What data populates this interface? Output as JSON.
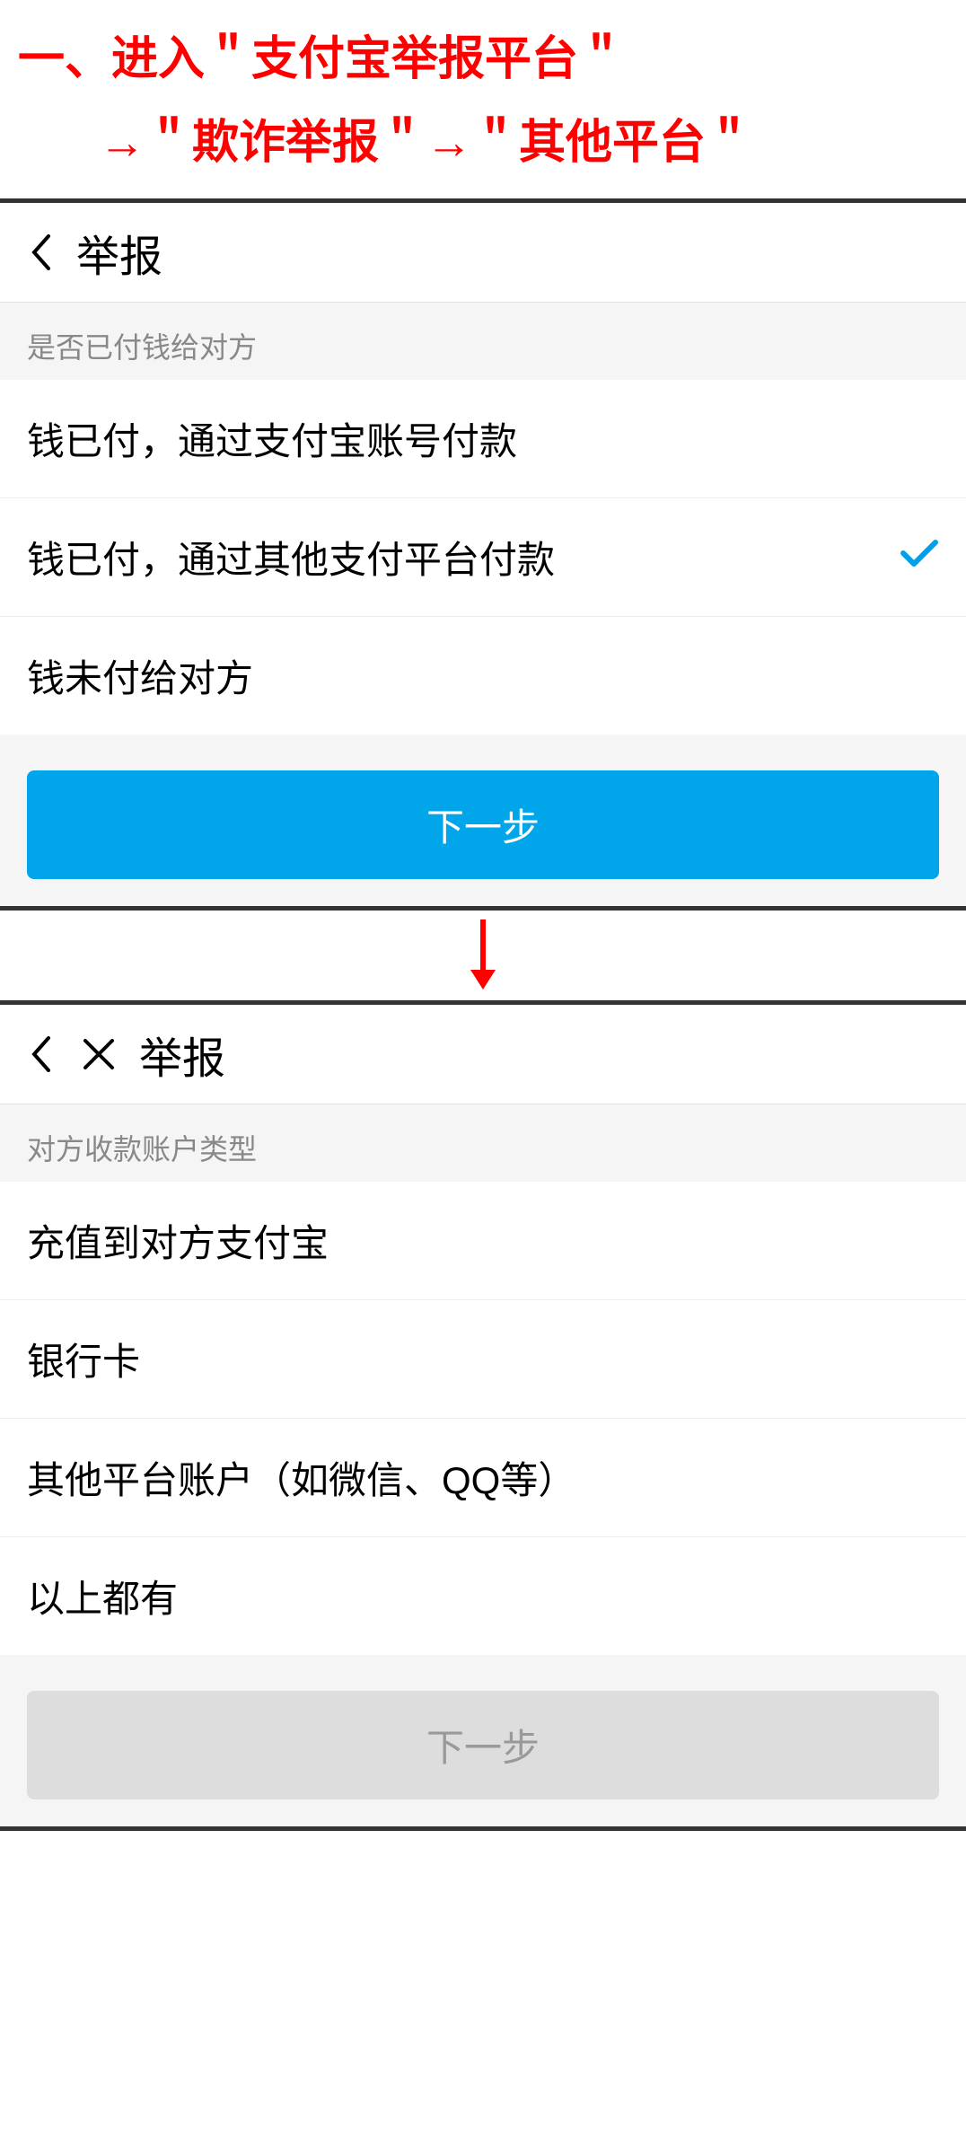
{
  "instruction": {
    "line1": "一、进入＂支付宝举报平台＂",
    "line2": "→＂欺诈举报＂→＂其他平台＂"
  },
  "screen1": {
    "header_title": "举报",
    "section_label": "是否已付钱给对方",
    "options": [
      "钱已付，通过支付宝账号付款",
      "钱已付，通过其他支付平台付款",
      "钱未付给对方"
    ],
    "selected_index": 1,
    "button_label": "下一步"
  },
  "screen2": {
    "header_title": "举报",
    "section_label": "对方收款账户类型",
    "options": [
      "充值到对方支付宝",
      "银行卡",
      "其他平台账户（如微信、QQ等）",
      "以上都有"
    ],
    "button_label": "下一步"
  }
}
